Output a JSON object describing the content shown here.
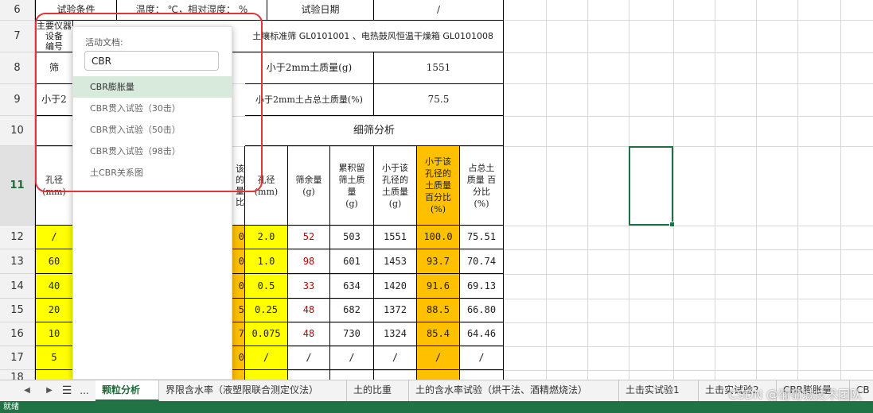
{
  "rows": [
    "6",
    "7",
    "8",
    "9",
    "10",
    "11",
    "12",
    "13",
    "14",
    "15",
    "16",
    "17",
    "18"
  ],
  "sheet": {
    "r6_label": "试验条件",
    "r6_cond": "温度：  ℃，相对湿度：  %",
    "r6_date_label": "试验日期",
    "r6_date_value": "/",
    "r7_label": "主要仪器设备\n编号",
    "r7_value": "土壤标准筛 GL0101001 、电热鼓风恒温干燥箱 GL0101008",
    "r8_label": "筛",
    "r8_mid": "小于2mm土质量(g)",
    "r8_value": "1551",
    "r9_label": "小于2",
    "r9_mid": "小于2mm土占总土质量(%)",
    "r9_value": "75.5",
    "r10_fine": "细筛分析",
    "h_aperture": "孔径\n(mm)",
    "h_partial": "该\n的\n量\n比",
    "h_aperture2": "孔径\n(mm)",
    "h_retained": "筛余量\n(g)",
    "h_cumulative": "累积留\n筛土质\n量\n(g)",
    "h_passing_mass": "小于该\n孔径的\n土质量\n(g)",
    "h_passing_pct": "小于该\n孔径的\n土质量\n百分比\n(%)",
    "h_total_pct": "占总土\n质量 百\n分比\n(%)"
  },
  "data_rows": [
    {
      "a": "/",
      "b": "0",
      "c": "2.0",
      "d": "52",
      "e": "503",
      "f": "1551",
      "g": "100.0",
      "h": "75.51"
    },
    {
      "a": "60",
      "b": "0",
      "c": "1.0",
      "d": "98",
      "e": "601",
      "f": "1453",
      "g": "93.7",
      "h": "70.74"
    },
    {
      "a": "40",
      "b": "0",
      "c": "0.5",
      "d": "33",
      "e": "634",
      "f": "1420",
      "g": "91.6",
      "h": "69.13"
    },
    {
      "a": "20",
      "b": "5",
      "c": "0.25",
      "d": "48",
      "e": "682",
      "f": "1372",
      "g": "88.5",
      "h": "66.80"
    },
    {
      "a": "10",
      "b": "7",
      "c": "0.075",
      "d": "48",
      "e": "730",
      "f": "1324",
      "g": "85.4",
      "h": "64.46"
    },
    {
      "a": "5",
      "b": "0",
      "c": "/",
      "d": "/",
      "e": "/",
      "f": "/",
      "g": "/",
      "h": "/"
    }
  ],
  "popup": {
    "title": "活动文档:",
    "search_value": "CBR",
    "items": [
      "CBR膨胀量",
      "CBR贯入试验（30击）",
      "CBR贯入试验（50击）",
      "CBR贯入试验（98击）",
      "土CBR关系图"
    ]
  },
  "tabs": [
    "颗粒分析",
    "界限含水率（液塑限联合测定仪法）",
    "土的比重",
    "土的含水率试验（烘干法、酒精燃烧法）",
    "土击实试验1",
    "土击实试验2",
    "CBR膨胀量",
    "CB"
  ],
  "tab_nav": {
    "prev": "◀",
    "next": "▶",
    "list": "☰",
    "more": "..."
  },
  "status": "就绪",
  "watermark": "CSDN @葡萄城技术团队",
  "colors": {
    "yellow": "#ffff00",
    "orange": "#ffc000",
    "accent": "#217346",
    "highlight_red": "#e0353b"
  }
}
